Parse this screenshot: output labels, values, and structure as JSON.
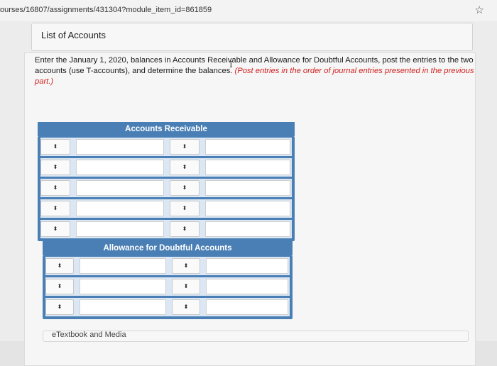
{
  "browser": {
    "url": "ourses/16807/assignments/431304?module_item_id=861859"
  },
  "list_of_accounts": {
    "label": "List of Accounts"
  },
  "instructions": {
    "main": "Enter the January 1, 2020, balances in Accounts Receivable and Allowance for Doubtful Accounts, post the entries to the two accounts (use T-accounts), and determine the balances.",
    "note": "(Post entries in the order of journal entries presented in the previous part.)"
  },
  "tables": {
    "ar": {
      "title": "Accounts Receivable"
    },
    "ada": {
      "title": "Allowance for Doubtful Accounts"
    }
  },
  "select_glyph": "⬍",
  "footer": {
    "etextbook": "eTextbook and Media"
  }
}
